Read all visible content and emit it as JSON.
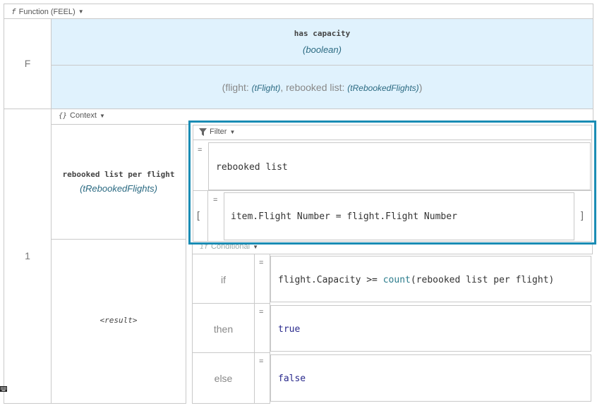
{
  "function_header": {
    "icon": "f",
    "label": "Function (FEEL)"
  },
  "row_function": {
    "label": "F"
  },
  "decision": {
    "name": "has capacity",
    "type": "(boolean)"
  },
  "parameters": {
    "open": "(",
    "p1_name": "flight: ",
    "p1_type": "(tFlight)",
    "sep": ", ",
    "p2_name": "rebooked list: ",
    "p2_type": "(tRebookedFlights)",
    "close": ")"
  },
  "row_number": "1",
  "context_header": {
    "icon": "{}",
    "label": "Context"
  },
  "context_entry": {
    "name": "rebooked list per flight",
    "type": "(tRebookedFlights)"
  },
  "result_label": "<result>",
  "filter": {
    "label": "Filter",
    "eq": "=",
    "expression": "rebooked list",
    "open_bracket": "[",
    "close_bracket": "]",
    "condition": "item.Flight Number = flight.Flight Number"
  },
  "conditional": {
    "icon": "if",
    "label": "Conditional",
    "if_label": "if",
    "then_label": "then",
    "else_label": "else",
    "eq": "=",
    "if_expr_pre": "flight.Capacity >= ",
    "if_expr_fn": "count",
    "if_expr_post": "(rebooked list per flight)",
    "then_expr": "true",
    "else_expr": "false"
  },
  "colors": {
    "header_bg": "#e0f2fd",
    "selection": "#1a8cb4"
  }
}
